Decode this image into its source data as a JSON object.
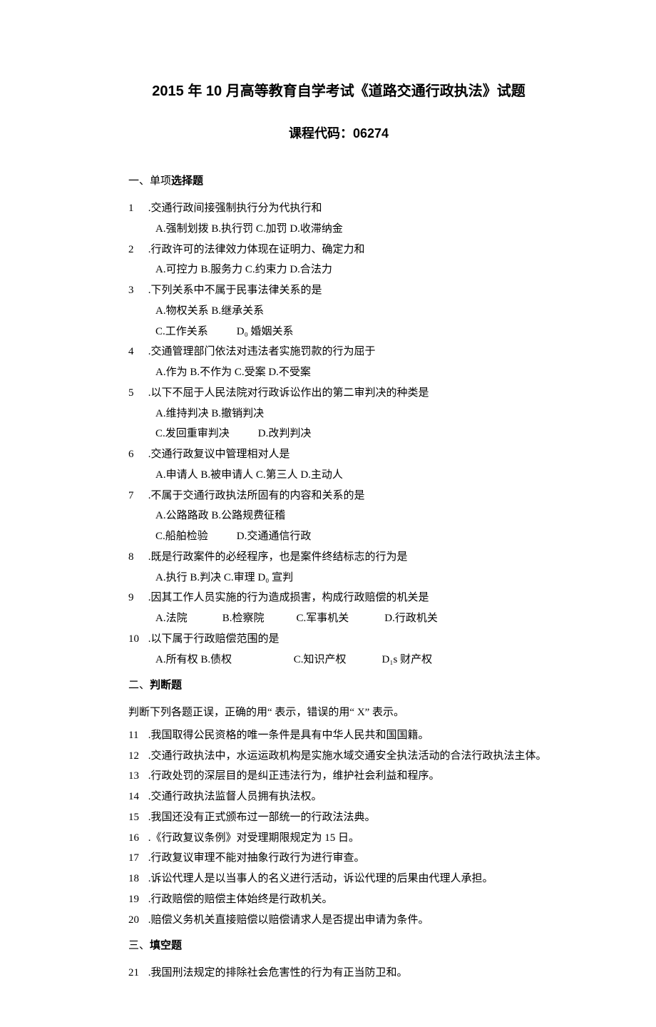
{
  "title": "2015 年 10 月高等教育自学考试《道路交通行政执法》试题",
  "subtitle": "课程代码：06274",
  "section1": {
    "prefix": "一、",
    "label_prefix": "单项",
    "label_bold": "选择题"
  },
  "q1": {
    "num": "1",
    "stem": " .交通行政间接强制执行分为代执行和",
    "opt": "A.强制划拨 B.执行罚 C.加罚 D.收滞纳金"
  },
  "q2": {
    "num": "2",
    "stem": " .行政许可的法律效力体现在证明力、确定力和",
    "opt": "A.可控力 B.服务力 C.约束力 D.合法力"
  },
  "q3": {
    "num": "3",
    "stem": " .下列关系中不属于民事法律关系的是",
    "opt1": "A.物权关系 B.继承关系",
    "opt2a": "C.工作关系",
    "opt2b": "D₀ 婚姻关系"
  },
  "q4": {
    "num": "4",
    "stem": " .交通管理部门依法对违法者实施罚款的行为屈于",
    "opt": "A.作为 B.不作为 C.受案 D.不受案"
  },
  "q5": {
    "num": "5",
    "stem": " .以下不屈于人民法院对行政诉讼作出的第二审判决的种类是",
    "opt1": "A.维持判决 B.撤销判决",
    "opt2a": "C.发回重审判决",
    "opt2b": "D.改判判决"
  },
  "q6": {
    "num": "6",
    "stem": " .交通行政复议中管理相对人是",
    "opt": "A.申请人 B.被申请人 C.第三人 D.主动人"
  },
  "q7": {
    "num": "7",
    "stem": " .不属于交通行政执法所固有的内容和关系的是",
    "opt1": "A.公路路政 B.公路规费征稽",
    "opt2a": "C.船舶检验",
    "opt2b": "D.交通通信行政"
  },
  "q8": {
    "num": "8",
    "stem": " .既是行政案件的必经程序，也是案件终结标志的行为是",
    "opt": "A.执行 B.判决 C.审理 D₀ 宣判"
  },
  "q9": {
    "num": "9",
    "stem": " .因其工作人员实施的行为造成损害，构成行政赔偿的机关是",
    "optA": "A.法院",
    "optB": "B.检察院",
    "optC": "C.军事机关",
    "optD": "D.行政机关"
  },
  "q10": {
    "num": "10",
    "stem": " .以下属于行政赔偿范围的是",
    "optAB": "A.所有权 B.债权",
    "optC": "C.知识产权",
    "optD": "D₁s 财产权"
  },
  "section2": {
    "prefix": "二、",
    "label_bold": "判断题"
  },
  "instr2": "判断下列各题正误，正确的用“ 表示，错误的用“ X” 表示。",
  "j11": {
    "num": "11",
    "text": " .我国取得公民资格的唯一条件是具有中华人民共和国国籍。"
  },
  "j12": {
    "num": "12",
    "text": " .交通行政执法中，水运运政机构是实施水域交通安全执法活动的合法行政执法主体。"
  },
  "j13": {
    "num": "13",
    "text": " .行政处罚的深层目的是纠正违法行为，维护社会利益和程序。"
  },
  "j14": {
    "num": "14",
    "text": " .交通行政执法监督人员拥有执法权。"
  },
  "j15": {
    "num": "15",
    "text": " .我国还没有正式颁布过一部统一的行政法法典。"
  },
  "j16": {
    "num": "16",
    "text": " .《行政复议条例》对受理期限规定为 15 日。"
  },
  "j17": {
    "num": "17",
    "text": " .行政复议审理不能对抽象行政行为进行审查。"
  },
  "j18": {
    "num": "18",
    "text": " .诉讼代理人是以当事人的名义进行活动，诉讼代理的后果由代理人承担。"
  },
  "j19": {
    "num": "19",
    "text": " .行政赔偿的赔偿主体始终是行政机关。"
  },
  "j20": {
    "num": "20",
    "text": " .赔偿义务机关直接赔偿以赔偿请求人是否提出申请为条件。"
  },
  "section3": {
    "prefix": "三、",
    "label_bold": "填空题"
  },
  "f21": {
    "num": "21",
    "text": " .我国刑法规定的排除社会危害性的行为有正当防卫和。"
  }
}
